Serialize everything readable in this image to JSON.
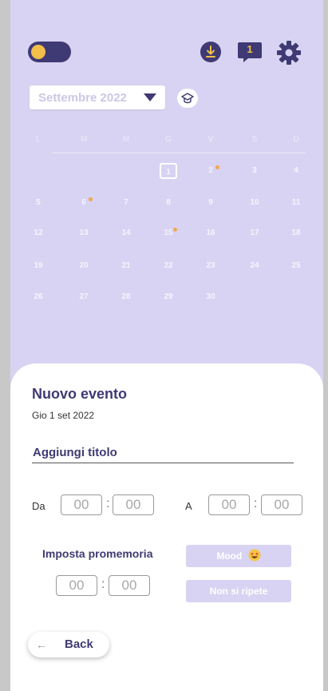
{
  "header": {
    "toggle_state": "on",
    "download_icon": "download-icon",
    "messages_icon": "message-badge-icon",
    "messages_count": "1",
    "settings_icon": "gear-icon"
  },
  "calendar": {
    "month_label": "Settembre 2022",
    "weekdays": [
      "L",
      "M",
      "M",
      "G",
      "V",
      "S",
      "D"
    ],
    "today": "1",
    "event_days": [
      "2",
      "6",
      "15"
    ],
    "weeks": [
      [
        "",
        "",
        "",
        "1",
        "2",
        "3",
        "4"
      ],
      [
        "5",
        "6",
        "7",
        "8",
        "9",
        "10",
        "11"
      ],
      [
        "12",
        "13",
        "14",
        "15",
        "16",
        "17",
        "18"
      ],
      [
        "19",
        "20",
        "21",
        "22",
        "23",
        "24",
        "25"
      ],
      [
        "26",
        "27",
        "28",
        "29",
        "30",
        "",
        ""
      ]
    ]
  },
  "event_form": {
    "title": "Nuovo evento",
    "date": "Gio 1 set 2022",
    "title_placeholder": "Aggiungi titolo",
    "from_label": "Da",
    "to_label": "A",
    "from_hours": "00",
    "from_minutes": "00",
    "to_hours": "00",
    "to_minutes": "00",
    "reminder_label": "Imposta promemoria",
    "reminder_hours": "00",
    "reminder_minutes": "00",
    "mood_label": "Mood",
    "repeat_label": "Non si ripete",
    "back_label": "Back"
  },
  "colors": {
    "background": "#d8d3f2",
    "primary": "#3f3a73",
    "accent": "#f2bf4a",
    "event_dot": "#f0a94b"
  }
}
